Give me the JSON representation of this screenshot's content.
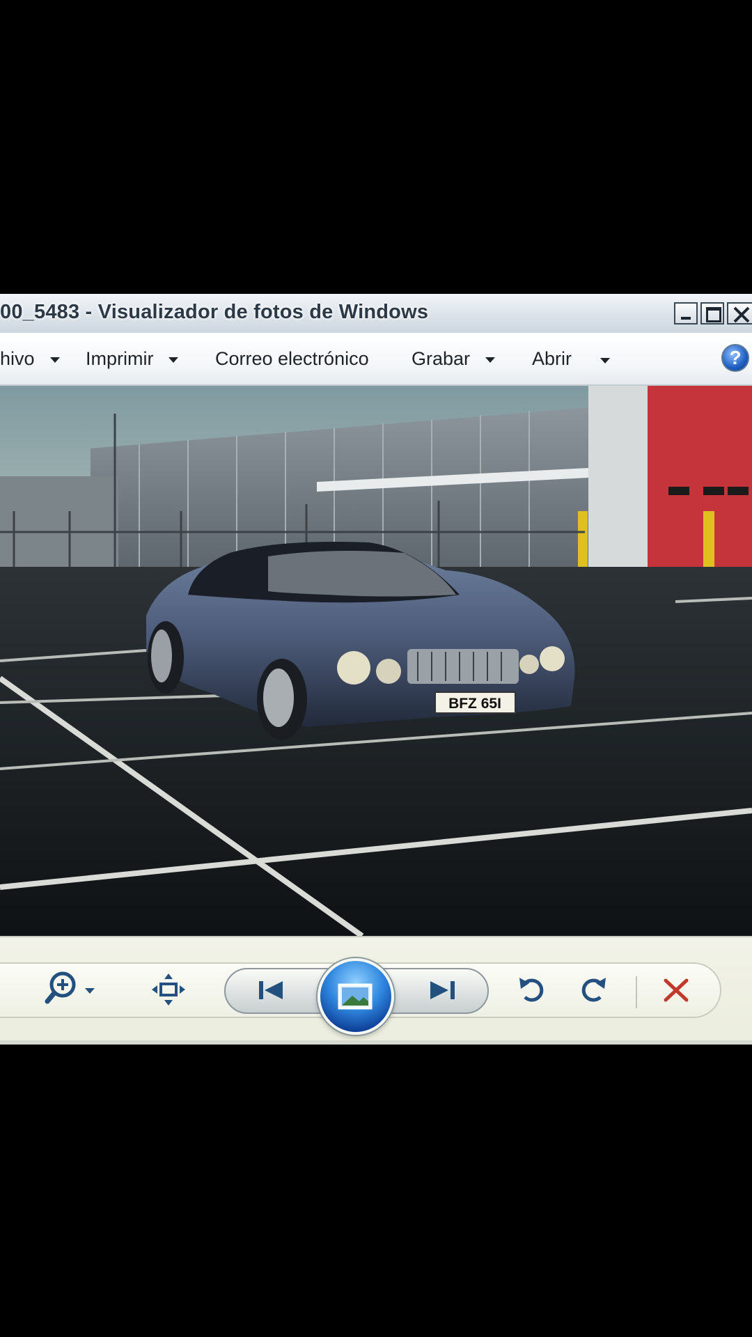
{
  "window": {
    "title": "00_5483 - Visualizador de fotos de Windows",
    "caption_buttons": [
      "minimize-icon",
      "maximize-icon",
      "close-icon"
    ]
  },
  "menu": {
    "items": [
      {
        "label": "hivo",
        "has_dropdown": true
      },
      {
        "label": "Imprimir",
        "has_dropdown": true
      },
      {
        "label": "Correo electrónico",
        "has_dropdown": false
      },
      {
        "label": "Grabar",
        "has_dropdown": true
      },
      {
        "label": "Abrir",
        "has_dropdown": true
      }
    ],
    "help_icon": "help-icon",
    "help_glyph": "?"
  },
  "photo": {
    "plate_text": "BFZ 65I"
  },
  "toolbar": {
    "icons": [
      "zoom-icon",
      "fit-window-icon",
      "previous-icon",
      "slideshow-icon",
      "next-icon",
      "rotate-left-icon",
      "rotate-right-icon",
      "delete-icon"
    ]
  },
  "colors": {
    "titlebar": "#dfe6ec",
    "menubar": "#f4f7f9",
    "toolbar": "#eef0e4",
    "slideshow_blue": "#2f86de",
    "delete_red": "#c0392b",
    "icon_blue": "#23507e"
  }
}
